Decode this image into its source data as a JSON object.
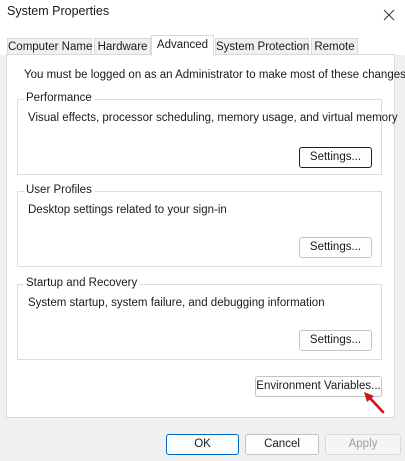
{
  "window": {
    "title": "System Properties"
  },
  "icons": {
    "close": "close-icon",
    "pointer": "red-arrow-icon"
  },
  "colors": {
    "focus_border": "#1f1f1f",
    "default_button_border": "#0067c0",
    "annotation_arrow": "#d0121b"
  },
  "tabs": [
    {
      "label": "Computer Name",
      "active": false
    },
    {
      "label": "Hardware",
      "active": false
    },
    {
      "label": "Advanced",
      "active": true
    },
    {
      "label": "System Protection",
      "active": false
    },
    {
      "label": "Remote",
      "active": false
    }
  ],
  "advanced": {
    "admin_note": "You must be logged on as an Administrator to make most of these changes.",
    "performance": {
      "title": "Performance",
      "description": "Visual effects, processor scheduling, memory usage, and virtual memory",
      "button": "Settings..."
    },
    "user_profiles": {
      "title": "User Profiles",
      "description": "Desktop settings related to your sign-in",
      "button": "Settings..."
    },
    "startup_recovery": {
      "title": "Startup and Recovery",
      "description": "System startup, system failure, and debugging information",
      "button": "Settings..."
    },
    "env_button": "Environment Variables..."
  },
  "footer": {
    "ok": "OK",
    "cancel": "Cancel",
    "apply": "Apply"
  }
}
